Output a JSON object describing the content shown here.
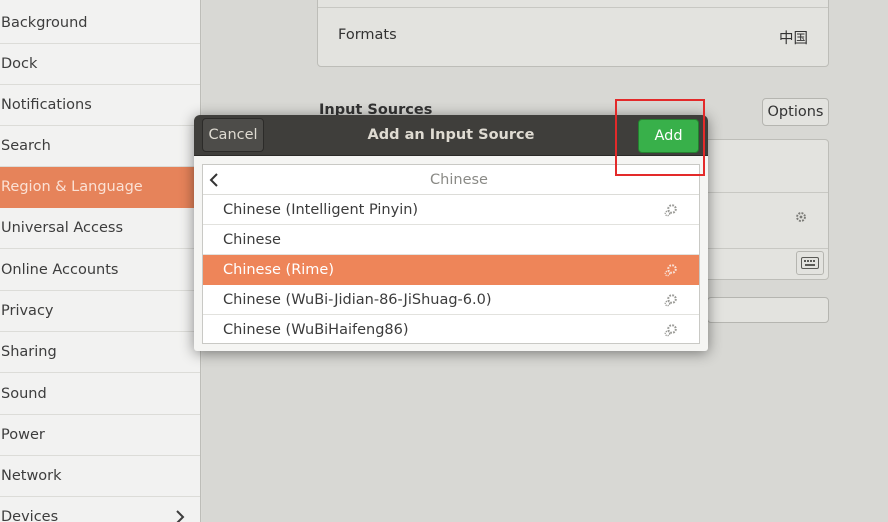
{
  "sidebar": {
    "items": [
      {
        "label": "Background"
      },
      {
        "label": "Dock"
      },
      {
        "label": "Notifications"
      },
      {
        "label": "Search"
      },
      {
        "label": "Region & Language",
        "active": true
      },
      {
        "label": "Universal Access"
      },
      {
        "label": "Online Accounts"
      },
      {
        "label": "Privacy"
      },
      {
        "label": "Sharing"
      },
      {
        "label": "Sound"
      },
      {
        "label": "Power"
      },
      {
        "label": "Network"
      },
      {
        "label": "Devices"
      }
    ],
    "devices_icon": "chevron-right-icon"
  },
  "main": {
    "formats_label": "Formats",
    "formats_value": "中国",
    "input_sources_label": "Input Sources",
    "options_label": "Options"
  },
  "dialog": {
    "title": "Add an Input Source",
    "cancel_label": "Cancel",
    "add_label": "Add",
    "list_header": "Chinese",
    "rows": [
      {
        "label": "Chinese (Intelligent Pinyin)",
        "has_settings": true,
        "selected": false
      },
      {
        "label": "Chinese",
        "has_settings": false,
        "selected": false
      },
      {
        "label": "Chinese (Rime)",
        "has_settings": true,
        "selected": true
      },
      {
        "label": "Chinese (WuBi-Jidian-86-JiShuag-6.0)",
        "has_settings": true,
        "selected": false
      },
      {
        "label": "Chinese (WuBiHaifeng86)",
        "has_settings": true,
        "selected": false
      }
    ]
  },
  "colors": {
    "accent": "#e6835a",
    "selection": "#ee8559",
    "add_button": "#38b04a",
    "header_bar": "#3f3e3b",
    "annotation": "#e32a2a"
  }
}
